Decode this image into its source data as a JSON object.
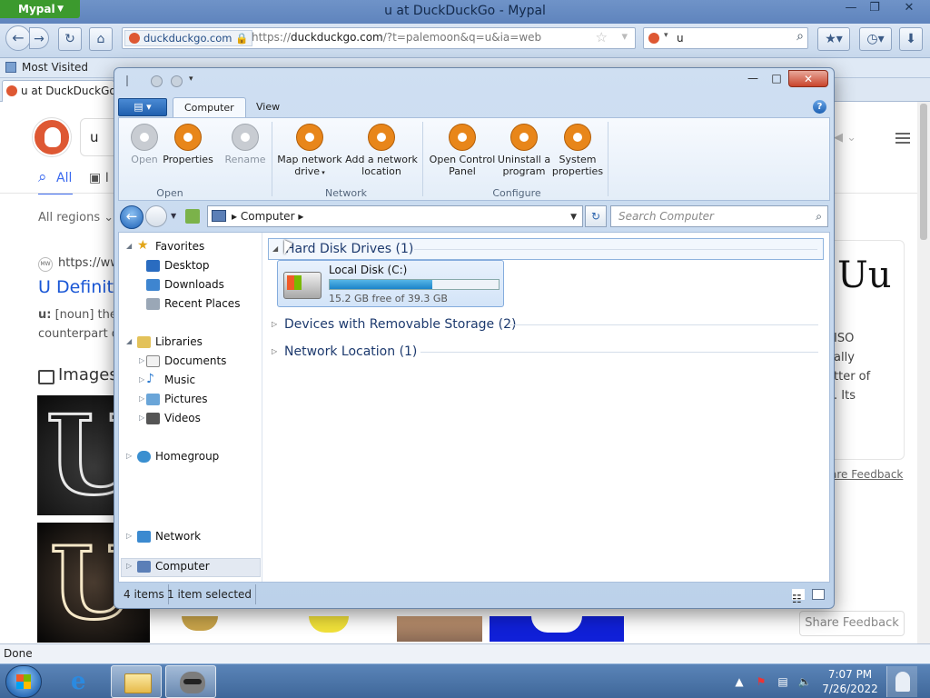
{
  "browser": {
    "app_menu_label": "Mypal",
    "window_title": "u at DuckDuckGo - Mypal",
    "site_identity": "duckduckgo.com",
    "url_prefix": "https://",
    "url_domain": "duckduckgo.com",
    "url_path": "/?t=palemoon&q=u&ia=web",
    "search_value": "u",
    "bookmark_label": "Most Visited",
    "tab_label": "u at DuckDuckGo",
    "status_text": "Done"
  },
  "ddg": {
    "query": "u",
    "tab_all": "All",
    "tab_images": "I",
    "regions": "All regions",
    "result_url": "https://ww",
    "result_favicon_text": "MW",
    "result_title": "U Definiti",
    "result_snippet_bold": "u:",
    "result_snippet_1": " [noun] the",
    "result_snippet_2": "counterpart o",
    "images_heading": "Images",
    "kp_title": "Uu",
    "kp_lines": [
      "ISO",
      "ally",
      "tter of",
      ". Its"
    ],
    "kp_feedback": "are Feedback",
    "share_feedback": "Share Feedback"
  },
  "explorer": {
    "ribbon_tabs": [
      "Computer",
      "View"
    ],
    "ribbon_items": [
      {
        "label": "Open",
        "enabled": false
      },
      {
        "label": "Properties",
        "enabled": true
      },
      {
        "label": "Rename",
        "enabled": false
      },
      {
        "label": "Map network drive",
        "line1": "Map network",
        "line2": "drive",
        "enabled": true
      },
      {
        "label": "Add a network location",
        "line1": "Add a network",
        "line2": "location",
        "enabled": true
      },
      {
        "label": "Open Control Panel",
        "line1": "Open Control",
        "line2": "Panel",
        "enabled": true
      },
      {
        "label": "Uninstall a program",
        "line1": "Uninstall a",
        "line2": "program",
        "enabled": true
      },
      {
        "label": "System properties",
        "line1": "System",
        "line2": "properties",
        "enabled": true
      }
    ],
    "ribbon_groups": [
      "Open",
      "Network",
      "Configure"
    ],
    "address_crumb": "Computer",
    "search_placeholder": "Search Computer",
    "nav": {
      "favorites": "Favorites",
      "favorites_items": [
        "Desktop",
        "Downloads",
        "Recent Places"
      ],
      "libraries": "Libraries",
      "libraries_items": [
        "Documents",
        "Music",
        "Pictures",
        "Videos"
      ],
      "homegroup": "Homegroup",
      "computer": "Computer",
      "network": "Network"
    },
    "groups": [
      {
        "label": "Hard Disk Drives (1)",
        "expanded": true
      },
      {
        "label": "Devices with Removable Storage (2)",
        "expanded": false
      },
      {
        "label": "Network Location (1)",
        "expanded": false
      }
    ],
    "disk": {
      "name": "Local Disk (C:)",
      "free_text": "15.2 GB free of 39.3 GB",
      "used_fraction": 0.61
    },
    "status_items": "4 items",
    "status_selected": "1 item selected"
  },
  "taskbar": {
    "time": "7:07 PM",
    "date": "7/26/2022"
  }
}
